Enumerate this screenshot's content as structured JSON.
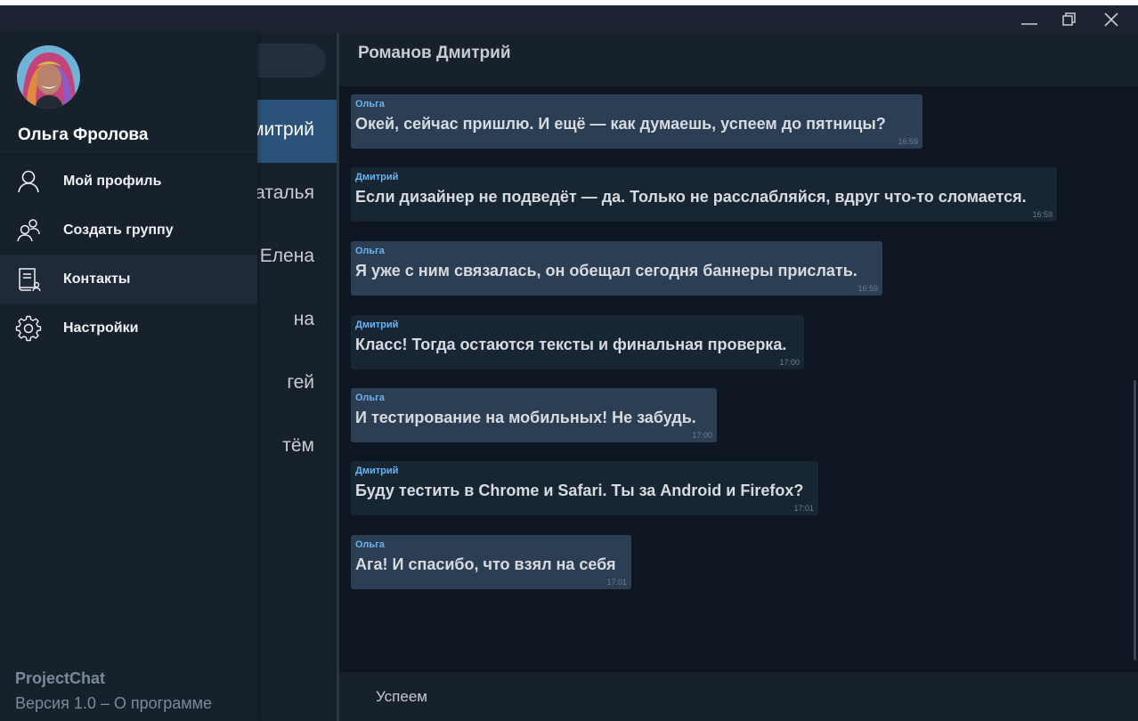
{
  "window": {
    "minimize": "—",
    "maximize": "❐",
    "close": "✕"
  },
  "chat_list": {
    "items": [
      {
        "name": "Дмитрий",
        "active": true
      },
      {
        "name": "Наталья"
      },
      {
        "name": "Елена"
      },
      {
        "name": "на"
      },
      {
        "name": "гей"
      },
      {
        "name": "тём"
      }
    ]
  },
  "header": {
    "title": "Романов Дмитрий"
  },
  "messages": [
    {
      "author": "Ольга",
      "text": "Окей, сейчас пришлю. И ещё — как думаешь, успеем до пятницы?",
      "time": "16:59",
      "own": true
    },
    {
      "author": "Дмитрий",
      "text": "Если дизайнер не подведёт — да. Только не расслабляйся, вдруг что-то сломается.",
      "time": "16:59",
      "own": false
    },
    {
      "author": "Ольга",
      "text": "Я уже с ним связалась, он обещал сегодня баннеры прислать.",
      "time": "16:59",
      "own": true
    },
    {
      "author": "Дмитрий",
      "text": "Класс! Тогда остаются тексты и финальная проверка.",
      "time": "17:00",
      "own": false
    },
    {
      "author": "Ольга",
      "text": "И тестирование на мобильных! Не забудь.",
      "time": "17:00",
      "own": true
    },
    {
      "author": "Дмитрий",
      "text": "Буду тестить в Chrome и Safari. Ты за Android и Firefox?",
      "time": "17:01",
      "own": false
    },
    {
      "author": "Ольга",
      "text": "Ага! И спасибо, что взял на себя",
      "time": "17:01",
      "own": true
    }
  ],
  "input": {
    "value": "Успеем"
  },
  "drawer": {
    "user_name": "Ольга Фролова",
    "menu": [
      {
        "label": "Мой профиль",
        "icon": "user-icon"
      },
      {
        "label": "Создать группу",
        "icon": "group-icon"
      },
      {
        "label": "Контакты",
        "icon": "contacts-icon"
      },
      {
        "label": "Настройки",
        "icon": "gear-icon"
      }
    ],
    "app_name": "ProjectChat",
    "app_version": "Версия 1.0 – О программе"
  },
  "colors": {
    "accent": "#2b5278",
    "outgoing_bubble": "#2b3e54",
    "incoming_bubble": "#182533",
    "author": "#6ab3f3"
  }
}
